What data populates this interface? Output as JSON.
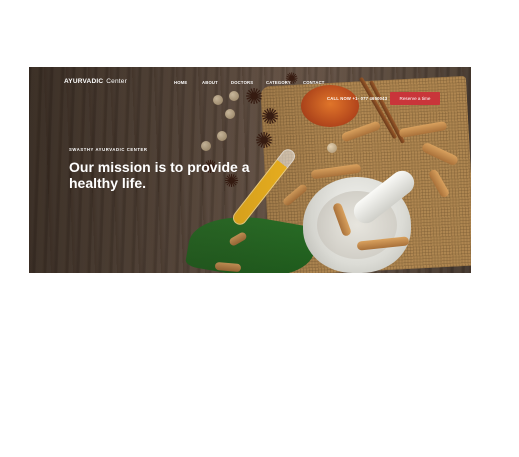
{
  "brand": {
    "logo_part1": "AYURVADIC",
    "logo_part2": "Center"
  },
  "nav": {
    "items": [
      {
        "label": "HOME"
      },
      {
        "label": "ABOUT"
      },
      {
        "label": "DOCTORS"
      },
      {
        "label": "CATEGORY"
      },
      {
        "label": "CONTACT"
      }
    ],
    "phone": "CALL NOW +1- 077 4650043",
    "reserve_label": "Reserve a time"
  },
  "hero": {
    "eyebrow": "SWASTHY AYURVADIC CENTER",
    "headline": "Our mission is to provide a healthy life."
  },
  "colors": {
    "accent": "#c9353a",
    "text": "#ffffff",
    "background": "#ffffff"
  }
}
